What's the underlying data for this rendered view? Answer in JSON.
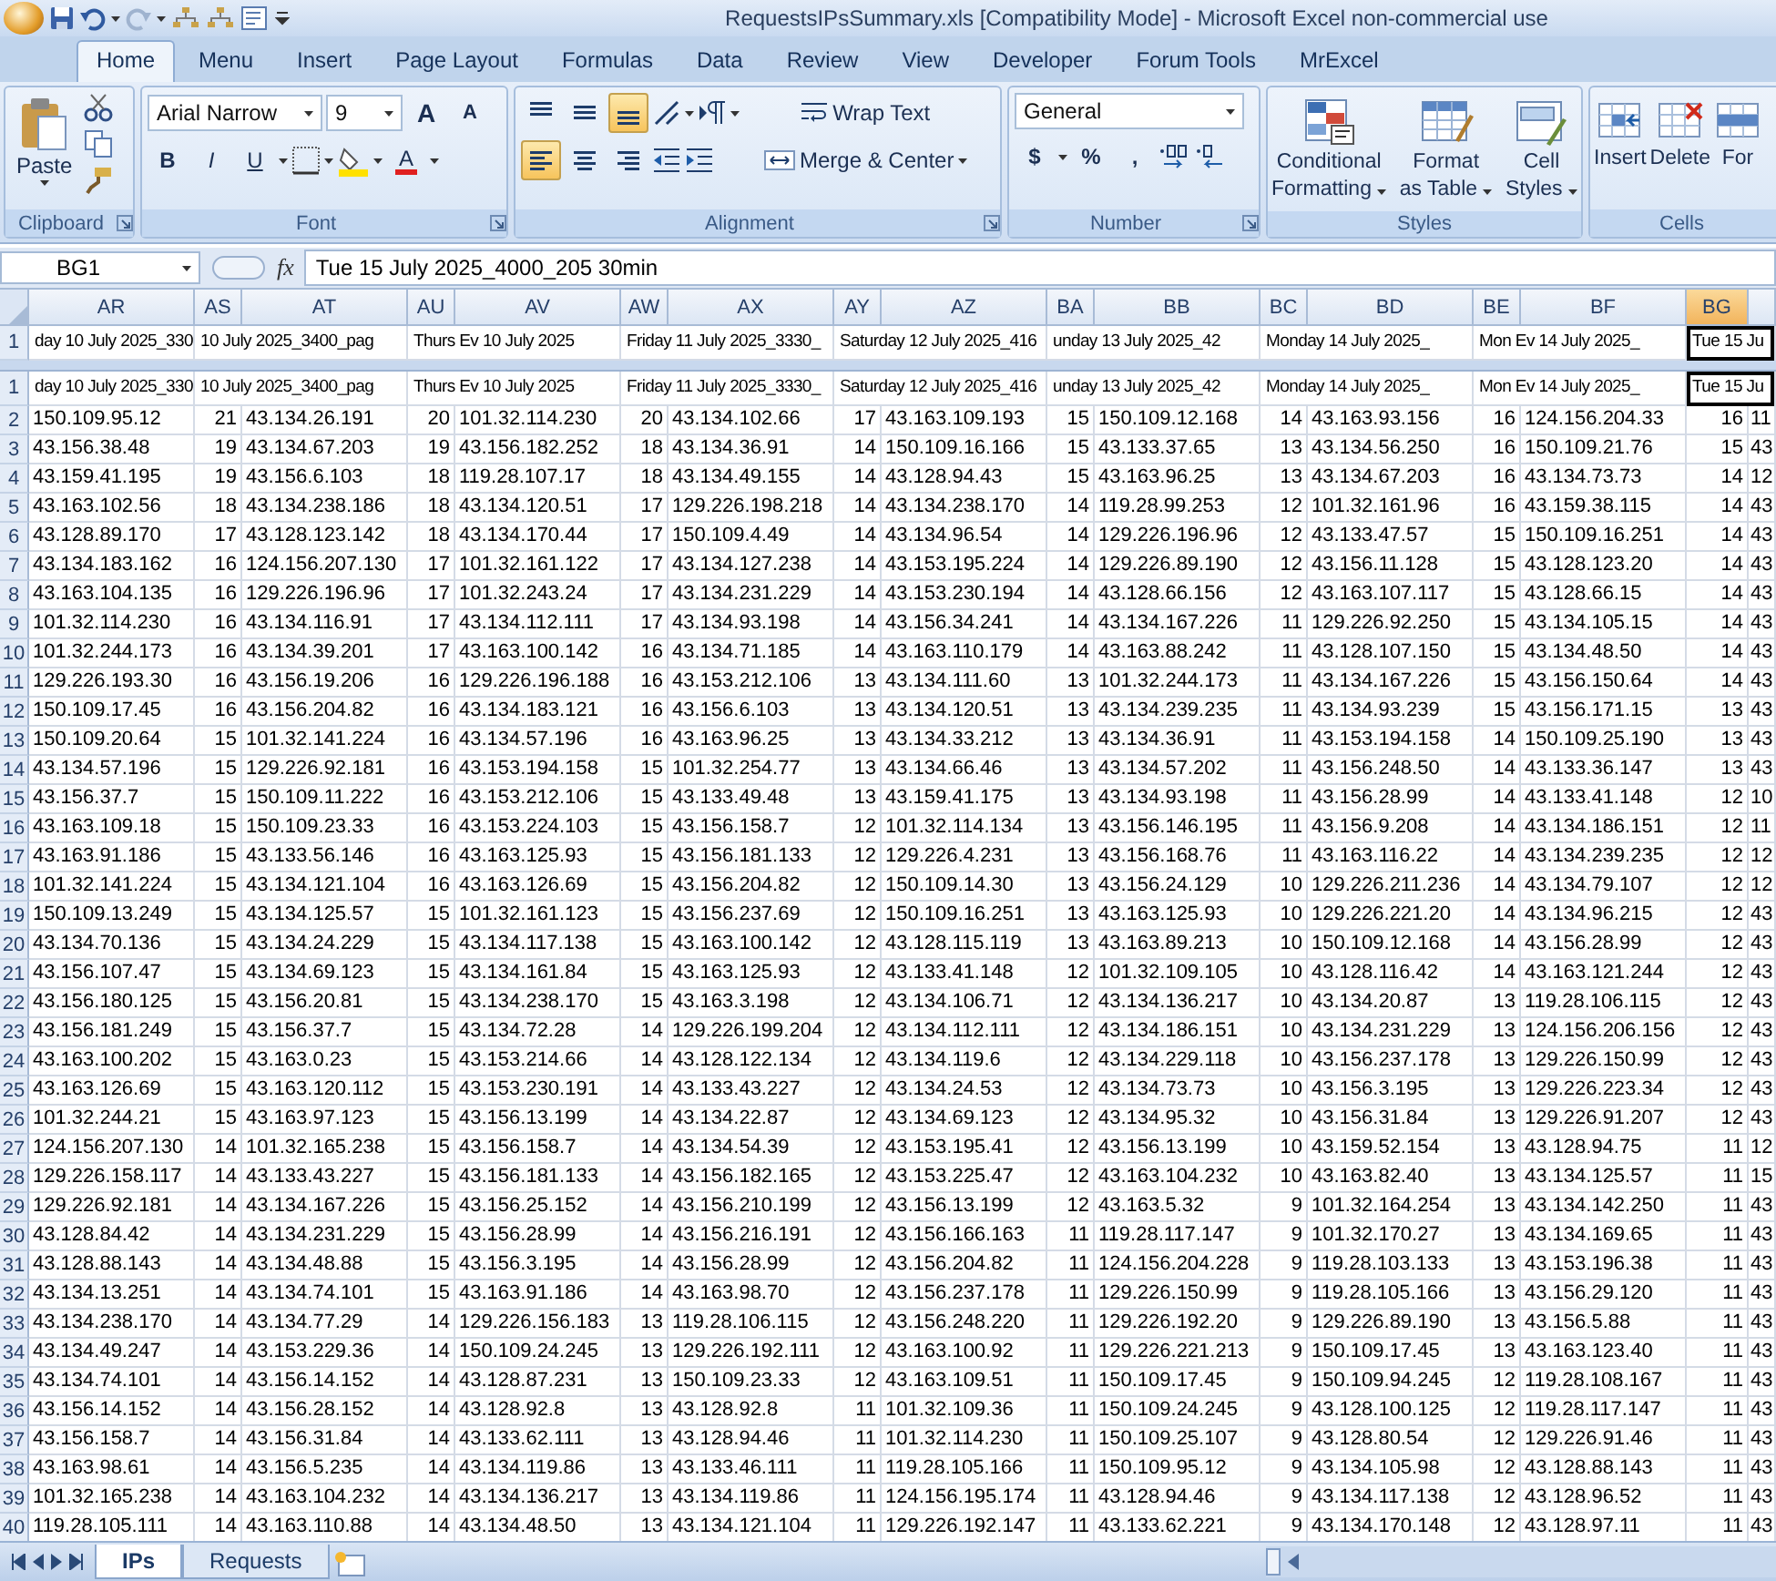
{
  "window": {
    "title": "RequestsIPsSummary.xls  [Compatibility Mode] - Microsoft Excel non-commercial use"
  },
  "ribbon_tabs": [
    {
      "label": "Home",
      "selected": true
    },
    {
      "label": "Menu",
      "selected": false
    },
    {
      "label": "Insert",
      "selected": false
    },
    {
      "label": "Page Layout",
      "selected": false
    },
    {
      "label": "Formulas",
      "selected": false
    },
    {
      "label": "Data",
      "selected": false
    },
    {
      "label": "Review",
      "selected": false
    },
    {
      "label": "View",
      "selected": false
    },
    {
      "label": "Developer",
      "selected": false
    },
    {
      "label": "Forum Tools",
      "selected": false
    },
    {
      "label": "MrExcel",
      "selected": false
    }
  ],
  "clipboard": {
    "label": "Clipboard",
    "paste": "Paste"
  },
  "font": {
    "label": "Font",
    "family": "Arial Narrow",
    "size": "9",
    "grow": "A",
    "shrink": "A",
    "bold": "B",
    "italic": "I",
    "underline": "U",
    "font_color_button": "A"
  },
  "alignment": {
    "label": "Alignment",
    "vertical": [
      {
        "kind": "top",
        "selected": false
      },
      {
        "kind": "middle",
        "selected": false
      },
      {
        "kind": "bottom",
        "selected": true
      }
    ],
    "horizontal": [
      {
        "kind": "left",
        "selected": true
      },
      {
        "kind": "center",
        "selected": false
      },
      {
        "kind": "right",
        "selected": false
      }
    ],
    "wrap": "Wrap Text",
    "merge": "Merge & Center"
  },
  "number": {
    "label": "Number",
    "format": "General",
    "currency": "$",
    "percent": "%",
    "comma": ","
  },
  "styles": {
    "label": "Styles",
    "buttons": [
      {
        "kind": "conditional",
        "lines": [
          "Conditional",
          "Formatting"
        ]
      },
      {
        "kind": "table",
        "lines": [
          "Format",
          "as Table"
        ]
      },
      {
        "kind": "cell",
        "lines": [
          "Cell",
          "Styles"
        ]
      }
    ]
  },
  "cells": {
    "label": "Cells",
    "buttons": [
      {
        "kind": "insert",
        "label": "Insert"
      },
      {
        "kind": "delete",
        "label": "Delete"
      },
      {
        "kind": "format",
        "label": "For"
      }
    ]
  },
  "formula_bar": {
    "name_box": "BG1",
    "fx": "fx",
    "value": "Tue 15 July 2025_4000_205 30min"
  },
  "columns": [
    {
      "letter": "AR",
      "kind": "address",
      "selected": false
    },
    {
      "letter": "AS",
      "kind": "count",
      "selected": false
    },
    {
      "letter": "AT",
      "kind": "address",
      "selected": false
    },
    {
      "letter": "AU",
      "kind": "count",
      "selected": false
    },
    {
      "letter": "AV",
      "kind": "address",
      "selected": false
    },
    {
      "letter": "AW",
      "kind": "count",
      "selected": false
    },
    {
      "letter": "AX",
      "kind": "address",
      "selected": false
    },
    {
      "letter": "AY",
      "kind": "count",
      "selected": false
    },
    {
      "letter": "AZ",
      "kind": "address",
      "selected": false
    },
    {
      "letter": "BA",
      "kind": "count",
      "selected": false
    },
    {
      "letter": "BB",
      "kind": "address",
      "selected": false
    },
    {
      "letter": "BC",
      "kind": "count",
      "selected": false
    },
    {
      "letter": "BD",
      "kind": "address",
      "selected": false
    },
    {
      "letter": "BE",
      "kind": "count",
      "selected": false
    },
    {
      "letter": "BF",
      "kind": "address",
      "selected": false
    },
    {
      "letter": "BG",
      "kind": "count",
      "selected": true
    },
    {
      "kind": "partial",
      "selected": false
    }
  ],
  "title_rows": [
    {
      "number": "1",
      "cells": [
        {
          "text": "day 10 July 2025_330",
          "kind": "single"
        },
        {
          "text": "10 July 2025_3400_pag",
          "kind": "pair"
        },
        {
          "text": "Thurs Ev 10 July 2025",
          "kind": "pair"
        },
        {
          "text": "Friday 11 July 2025_3330_",
          "kind": "pair"
        },
        {
          "text": "Saturday 12 July 2025_416",
          "kind": "pair"
        },
        {
          "text": "unday 13 July 2025_42",
          "kind": "pair"
        },
        {
          "text": "Monday 14 July 2025_",
          "kind": "pair"
        },
        {
          "text": "Mon Ev 14 July 2025_",
          "kind": "pair"
        },
        {
          "text": "Tue 15 Ju",
          "kind": "pair"
        }
      ]
    },
    {
      "number": "1",
      "cells": [
        {
          "text": "day 10 July 2025_330",
          "kind": "single"
        },
        {
          "text": "10 July 2025_3400_pag",
          "kind": "pair"
        },
        {
          "text": "Thurs Ev 10 July 2025",
          "kind": "pair"
        },
        {
          "text": "Friday 11 July 2025_3330_",
          "kind": "pair"
        },
        {
          "text": "Saturday 12 July 2025_416",
          "kind": "pair"
        },
        {
          "text": "unday 13 July 2025_42",
          "kind": "pair"
        },
        {
          "text": "Monday 14 July 2025_",
          "kind": "pair"
        },
        {
          "text": "Mon Ev 14 July 2025_",
          "kind": "pair"
        },
        {
          "text": "Tue 15 Ju",
          "kind": "pair"
        }
      ]
    }
  ],
  "rows": [
    {
      "number": "2",
      "cells": [
        "150.109.95.12",
        "21",
        "43.134.26.191",
        "20",
        "101.32.114.230",
        "20",
        "43.134.102.66",
        "17",
        "43.163.109.193",
        "15",
        "150.109.12.168",
        "14",
        "43.163.93.156",
        "16",
        "124.156.204.33",
        "16",
        "11"
      ]
    },
    {
      "number": "3",
      "cells": [
        "43.156.38.48",
        "19",
        "43.134.67.203",
        "19",
        "43.156.182.252",
        "18",
        "43.134.36.91",
        "14",
        "150.109.16.166",
        "15",
        "43.133.37.65",
        "13",
        "43.134.56.250",
        "16",
        "150.109.21.76",
        "15",
        "43"
      ]
    },
    {
      "number": "4",
      "cells": [
        "43.159.41.195",
        "19",
        "43.156.6.103",
        "18",
        "119.28.107.17",
        "18",
        "43.134.49.155",
        "14",
        "43.128.94.43",
        "15",
        "43.163.96.25",
        "13",
        "43.134.67.203",
        "16",
        "43.134.73.73",
        "14",
        "12"
      ]
    },
    {
      "number": "5",
      "cells": [
        "43.163.102.56",
        "18",
        "43.134.238.186",
        "18",
        "43.134.120.51",
        "17",
        "129.226.198.218",
        "14",
        "43.134.238.170",
        "14",
        "119.28.99.253",
        "12",
        "101.32.161.96",
        "16",
        "43.159.38.115",
        "14",
        "43"
      ]
    },
    {
      "number": "6",
      "cells": [
        "43.128.89.170",
        "17",
        "43.128.123.142",
        "18",
        "43.134.170.44",
        "17",
        "150.109.4.49",
        "14",
        "43.134.96.54",
        "14",
        "129.226.196.96",
        "12",
        "43.133.47.57",
        "15",
        "150.109.16.251",
        "14",
        "43"
      ]
    },
    {
      "number": "7",
      "cells": [
        "43.134.183.162",
        "16",
        "124.156.207.130",
        "17",
        "101.32.161.122",
        "17",
        "43.134.127.238",
        "14",
        "43.153.195.224",
        "14",
        "129.226.89.190",
        "12",
        "43.156.11.128",
        "15",
        "43.128.123.20",
        "14",
        "43"
      ]
    },
    {
      "number": "8",
      "cells": [
        "43.163.104.135",
        "16",
        "129.226.196.96",
        "17",
        "101.32.243.24",
        "17",
        "43.134.231.229",
        "14",
        "43.153.230.194",
        "14",
        "43.128.66.156",
        "12",
        "43.163.107.117",
        "15",
        "43.128.66.15",
        "14",
        "43"
      ]
    },
    {
      "number": "9",
      "cells": [
        "101.32.114.230",
        "16",
        "43.134.116.91",
        "17",
        "43.134.112.111",
        "17",
        "43.134.93.198",
        "14",
        "43.156.34.241",
        "14",
        "43.134.167.226",
        "11",
        "129.226.92.250",
        "15",
        "43.134.105.15",
        "14",
        "43"
      ]
    },
    {
      "number": "10",
      "cells": [
        "101.32.244.173",
        "16",
        "43.134.39.201",
        "17",
        "43.163.100.142",
        "16",
        "43.134.71.185",
        "14",
        "43.163.110.179",
        "14",
        "43.163.88.242",
        "11",
        "43.128.107.150",
        "15",
        "43.134.48.50",
        "14",
        "43"
      ]
    },
    {
      "number": "11",
      "cells": [
        "129.226.193.30",
        "16",
        "43.156.19.206",
        "16",
        "129.226.196.188",
        "16",
        "43.153.212.106",
        "13",
        "43.134.111.60",
        "13",
        "101.32.244.173",
        "11",
        "43.134.167.226",
        "15",
        "43.156.150.64",
        "14",
        "43"
      ]
    },
    {
      "number": "12",
      "cells": [
        "150.109.17.45",
        "16",
        "43.156.204.82",
        "16",
        "43.134.183.121",
        "16",
        "43.156.6.103",
        "13",
        "43.134.120.51",
        "13",
        "43.134.239.235",
        "11",
        "43.134.93.239",
        "15",
        "43.156.171.15",
        "13",
        "43"
      ]
    },
    {
      "number": "13",
      "cells": [
        "150.109.20.64",
        "15",
        "101.32.141.224",
        "16",
        "43.134.57.196",
        "16",
        "43.163.96.25",
        "13",
        "43.134.33.212",
        "13",
        "43.134.36.91",
        "11",
        "43.153.194.158",
        "14",
        "150.109.25.190",
        "13",
        "43"
      ]
    },
    {
      "number": "14",
      "cells": [
        "43.134.57.196",
        "15",
        "129.226.92.181",
        "16",
        "43.153.194.158",
        "15",
        "101.32.254.77",
        "13",
        "43.134.66.46",
        "13",
        "43.134.57.202",
        "11",
        "43.156.248.50",
        "14",
        "43.133.36.147",
        "13",
        "43"
      ]
    },
    {
      "number": "15",
      "cells": [
        "43.156.37.7",
        "15",
        "150.109.11.222",
        "16",
        "43.153.212.106",
        "15",
        "43.133.49.48",
        "13",
        "43.159.41.175",
        "13",
        "43.134.93.198",
        "11",
        "43.156.28.99",
        "14",
        "43.133.41.148",
        "12",
        "10"
      ]
    },
    {
      "number": "16",
      "cells": [
        "43.163.109.18",
        "15",
        "150.109.23.33",
        "16",
        "43.153.224.103",
        "15",
        "43.156.158.7",
        "12",
        "101.32.114.134",
        "13",
        "43.156.146.195",
        "11",
        "43.156.9.208",
        "14",
        "43.134.186.151",
        "12",
        "11"
      ]
    },
    {
      "number": "17",
      "cells": [
        "43.163.91.186",
        "15",
        "43.133.56.146",
        "16",
        "43.163.125.93",
        "15",
        "43.156.181.133",
        "12",
        "129.226.4.231",
        "13",
        "43.156.168.76",
        "11",
        "43.163.116.22",
        "14",
        "43.134.239.235",
        "12",
        "12"
      ]
    },
    {
      "number": "18",
      "cells": [
        "101.32.141.224",
        "15",
        "43.134.121.104",
        "16",
        "43.163.126.69",
        "15",
        "43.156.204.82",
        "12",
        "150.109.14.30",
        "13",
        "43.156.24.129",
        "10",
        "129.226.211.236",
        "14",
        "43.134.79.107",
        "12",
        "12"
      ]
    },
    {
      "number": "19",
      "cells": [
        "150.109.13.249",
        "15",
        "43.134.125.57",
        "15",
        "101.32.161.123",
        "15",
        "43.156.237.69",
        "12",
        "150.109.16.251",
        "13",
        "43.163.125.93",
        "10",
        "129.226.221.20",
        "14",
        "43.134.96.215",
        "12",
        "43"
      ]
    },
    {
      "number": "20",
      "cells": [
        "43.134.70.136",
        "15",
        "43.134.24.229",
        "15",
        "43.134.117.138",
        "15",
        "43.163.100.142",
        "12",
        "43.128.115.119",
        "13",
        "43.163.89.213",
        "10",
        "150.109.12.168",
        "14",
        "43.156.28.99",
        "12",
        "43"
      ]
    },
    {
      "number": "21",
      "cells": [
        "43.156.107.47",
        "15",
        "43.134.69.123",
        "15",
        "43.134.161.84",
        "15",
        "43.163.125.93",
        "12",
        "43.133.41.148",
        "12",
        "101.32.109.105",
        "10",
        "43.128.116.42",
        "14",
        "43.163.121.244",
        "12",
        "43"
      ]
    },
    {
      "number": "22",
      "cells": [
        "43.156.180.125",
        "15",
        "43.156.20.81",
        "15",
        "43.134.238.170",
        "15",
        "43.163.3.198",
        "12",
        "43.134.106.71",
        "12",
        "43.134.136.217",
        "10",
        "43.134.20.87",
        "13",
        "119.28.106.115",
        "12",
        "43"
      ]
    },
    {
      "number": "23",
      "cells": [
        "43.156.181.249",
        "15",
        "43.156.37.7",
        "15",
        "43.134.72.28",
        "14",
        "129.226.199.204",
        "12",
        "43.134.112.111",
        "12",
        "43.134.186.151",
        "10",
        "43.134.231.229",
        "13",
        "124.156.206.156",
        "12",
        "43"
      ]
    },
    {
      "number": "24",
      "cells": [
        "43.163.100.202",
        "15",
        "43.163.0.23",
        "15",
        "43.153.214.66",
        "14",
        "43.128.122.134",
        "12",
        "43.134.119.6",
        "12",
        "43.134.229.118",
        "10",
        "43.156.237.178",
        "13",
        "129.226.150.99",
        "12",
        "43"
      ]
    },
    {
      "number": "25",
      "cells": [
        "43.163.126.69",
        "15",
        "43.163.120.112",
        "15",
        "43.153.230.191",
        "14",
        "43.133.43.227",
        "12",
        "43.134.24.53",
        "12",
        "43.134.73.73",
        "10",
        "43.156.3.195",
        "13",
        "129.226.223.34",
        "12",
        "43"
      ]
    },
    {
      "number": "26",
      "cells": [
        "101.32.244.21",
        "15",
        "43.163.97.123",
        "15",
        "43.156.13.199",
        "14",
        "43.134.22.87",
        "12",
        "43.134.69.123",
        "12",
        "43.134.95.32",
        "10",
        "43.156.31.84",
        "13",
        "129.226.91.207",
        "12",
        "43"
      ]
    },
    {
      "number": "27",
      "cells": [
        "124.156.207.130",
        "14",
        "101.32.165.238",
        "15",
        "43.156.158.7",
        "14",
        "43.134.54.39",
        "12",
        "43.153.195.41",
        "12",
        "43.156.13.199",
        "10",
        "43.159.52.154",
        "13",
        "43.128.94.75",
        "11",
        "12"
      ]
    },
    {
      "number": "28",
      "cells": [
        "129.226.158.117",
        "14",
        "43.133.43.227",
        "15",
        "43.156.181.133",
        "14",
        "43.156.182.165",
        "12",
        "43.153.225.47",
        "12",
        "43.163.104.232",
        "10",
        "43.163.82.40",
        "13",
        "43.134.125.57",
        "11",
        "15"
      ]
    },
    {
      "number": "29",
      "cells": [
        "129.226.92.181",
        "14",
        "43.134.167.226",
        "15",
        "43.156.25.152",
        "14",
        "43.156.210.199",
        "12",
        "43.156.13.199",
        "12",
        "43.163.5.32",
        "9",
        "101.32.164.254",
        "13",
        "43.134.142.250",
        "11",
        "43"
      ]
    },
    {
      "number": "30",
      "cells": [
        "43.128.84.42",
        "14",
        "43.134.231.229",
        "15",
        "43.156.28.99",
        "14",
        "43.156.216.191",
        "12",
        "43.156.166.163",
        "11",
        "119.28.117.147",
        "9",
        "101.32.170.27",
        "13",
        "43.134.169.65",
        "11",
        "43"
      ]
    },
    {
      "number": "31",
      "cells": [
        "43.128.88.143",
        "14",
        "43.134.48.88",
        "15",
        "43.156.3.195",
        "14",
        "43.156.28.99",
        "12",
        "43.156.204.82",
        "11",
        "124.156.204.228",
        "9",
        "119.28.103.133",
        "13",
        "43.153.196.38",
        "11",
        "43"
      ]
    },
    {
      "number": "32",
      "cells": [
        "43.134.13.251",
        "14",
        "43.134.74.101",
        "15",
        "43.163.91.186",
        "14",
        "43.163.98.70",
        "12",
        "43.156.237.178",
        "11",
        "129.226.150.99",
        "9",
        "119.28.105.166",
        "13",
        "43.156.29.120",
        "11",
        "43"
      ]
    },
    {
      "number": "33",
      "cells": [
        "43.134.238.170",
        "14",
        "43.134.77.29",
        "14",
        "129.226.156.183",
        "13",
        "119.28.106.115",
        "12",
        "43.156.248.220",
        "11",
        "129.226.192.20",
        "9",
        "129.226.89.190",
        "13",
        "43.156.5.88",
        "11",
        "43"
      ]
    },
    {
      "number": "34",
      "cells": [
        "43.134.49.247",
        "14",
        "43.153.229.36",
        "14",
        "150.109.24.245",
        "13",
        "129.226.192.111",
        "12",
        "43.163.100.92",
        "11",
        "129.226.221.213",
        "9",
        "150.109.17.45",
        "13",
        "43.163.123.40",
        "11",
        "43"
      ]
    },
    {
      "number": "35",
      "cells": [
        "43.134.74.101",
        "14",
        "43.156.14.152",
        "14",
        "43.128.87.231",
        "13",
        "150.109.23.33",
        "12",
        "43.163.109.51",
        "11",
        "150.109.17.45",
        "9",
        "150.109.94.245",
        "12",
        "119.28.108.167",
        "11",
        "43"
      ]
    },
    {
      "number": "36",
      "cells": [
        "43.156.14.152",
        "14",
        "43.156.28.152",
        "14",
        "43.128.92.8",
        "13",
        "43.128.92.8",
        "11",
        "101.32.109.36",
        "11",
        "150.109.24.245",
        "9",
        "43.128.100.125",
        "12",
        "119.28.117.147",
        "11",
        "43"
      ]
    },
    {
      "number": "37",
      "cells": [
        "43.156.158.7",
        "14",
        "43.156.31.84",
        "14",
        "43.133.62.111",
        "13",
        "43.128.94.46",
        "11",
        "101.32.114.230",
        "11",
        "150.109.25.107",
        "9",
        "43.128.80.54",
        "12",
        "129.226.91.46",
        "11",
        "43"
      ]
    },
    {
      "number": "38",
      "cells": [
        "43.163.98.61",
        "14",
        "43.156.5.235",
        "14",
        "43.134.119.86",
        "13",
        "43.133.46.111",
        "11",
        "119.28.105.166",
        "11",
        "150.109.95.12",
        "9",
        "43.134.105.98",
        "12",
        "43.128.88.143",
        "11",
        "43"
      ]
    },
    {
      "number": "39",
      "cells": [
        "101.32.165.238",
        "14",
        "43.163.104.232",
        "14",
        "43.134.136.217",
        "13",
        "43.134.119.86",
        "11",
        "124.156.195.174",
        "11",
        "43.128.94.46",
        "9",
        "43.134.117.138",
        "12",
        "43.128.96.52",
        "11",
        "43"
      ]
    },
    {
      "number": "40",
      "cells": [
        "119.28.105.111",
        "14",
        "43.163.110.88",
        "14",
        "43.134.48.50",
        "13",
        "43.134.121.104",
        "11",
        "129.226.192.147",
        "11",
        "43.133.62.221",
        "9",
        "43.134.170.148",
        "12",
        "43.128.97.11",
        "11",
        "43"
      ]
    }
  ],
  "sheet_tabs": [
    {
      "label": "IPs",
      "selected": true
    },
    {
      "label": "Requests",
      "selected": false
    }
  ]
}
